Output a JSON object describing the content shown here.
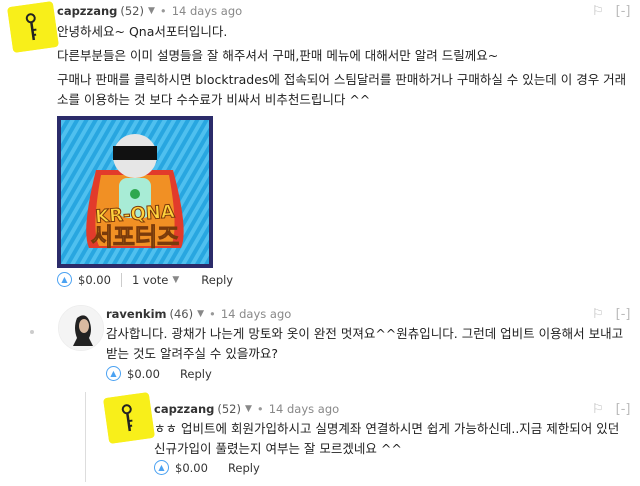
{
  "comments": [
    {
      "author": "capzzang",
      "reputation": "(52)",
      "time": "14 days ago",
      "paragraphs": [
        "안녕하세요~ Qna서포터입니다.",
        "다른부분들은 이미 설명들을 잘 해주셔서 구매,판매 메뉴에 대해서만 알려 드릴께요~",
        "구매나 판매를 클릭하시면 blocktrades에 접속되어 스팀달러를 판매하거나 구매하실 수 있는데 이 경우 거래소를 이용하는 것 보다 수수료가 비싸서 비추천드립니다 ^^"
      ],
      "image": {
        "line1": "KR-QNA",
        "line2": "서포터즈"
      },
      "payout": "$0.00",
      "votes": "1 vote",
      "reply": "Reply"
    },
    {
      "author": "ravenkim",
      "reputation": "(46)",
      "time": "14 days ago",
      "paragraphs": [
        "감사합니다. 광채가 나는게 망토와 옷이 완전 멋져요^^원츄입니다. 그런데 업비트 이용해서 보내고 받는 것도 알려주실 수 있을까요?"
      ],
      "payout": "$0.00",
      "reply": "Reply"
    },
    {
      "author": "capzzang",
      "reputation": "(52)",
      "time": "14 days ago",
      "paragraphs": [
        "ㅎㅎ 업비트에 회원가입하시고 실명계좌 연결하시면 쉽게 가능하신데..지금 제한되어 있던 신규가입이 풀렸는지 여부는 잘 모르겠네요 ^^"
      ],
      "payout": "$0.00",
      "reply": "Reply"
    }
  ],
  "colors": {
    "upvote": "#4ba2f2",
    "avatar_yellow": "#f8ef1a"
  },
  "icons": {
    "upvote": "chevron-up-circle-icon",
    "flag": "flag-icon",
    "collapse": "collapse-icon"
  }
}
